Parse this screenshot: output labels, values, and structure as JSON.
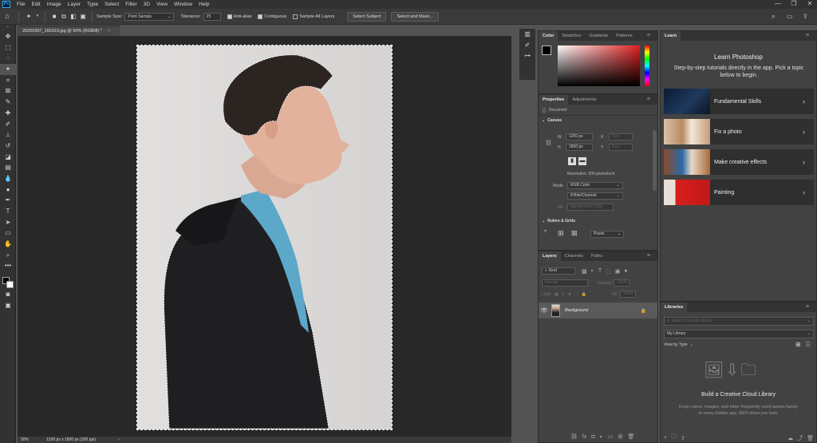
{
  "menu": {
    "logo": "Ps",
    "items": [
      "File",
      "Edit",
      "Image",
      "Layer",
      "Type",
      "Select",
      "Filter",
      "3D",
      "View",
      "Window",
      "Help"
    ],
    "window_controls": [
      "—",
      "❐",
      "✕"
    ]
  },
  "options": {
    "sample_size_label": "Sample Size:",
    "sample_size_value": "Point Sample",
    "tolerance_label": "Tolerance:",
    "tolerance_value": "25",
    "anti_alias": "Anti-alias",
    "contiguous": "Contiguous",
    "sample_all_layers": "Sample All Layers",
    "select_subject": "Select Subject",
    "select_and_mask": "Select and Mask..."
  },
  "document": {
    "tab_title": "20200307_160310.jpg @ 50% (RGB/8) *",
    "zoom": "50%",
    "dimensions": "1200 px x 1800 px (300 ppi)",
    "status_arrow": "›"
  },
  "color_panel": {
    "tabs": [
      "Color",
      "Swatches",
      "Gradients",
      "Patterns"
    ]
  },
  "properties_panel": {
    "tabs": [
      "Properties",
      "Adjustments"
    ],
    "document_label": "Document",
    "canvas_header": "Canvas",
    "w_label": "W",
    "w_value": "1200 px",
    "h_label": "H",
    "h_value": "1800 px",
    "x_label": "X",
    "x_placeholder": "0 px",
    "y_label": "Y",
    "y_placeholder": "0 px",
    "resolution": "Resolution: 300 pixels/inch",
    "mode_label": "Mode",
    "mode_value": "RGB Color",
    "bits_value": "8 Bits/Channel",
    "fill_label": "Fill",
    "fill_value": "Background Color",
    "rulers_header": "Rulers & Grids",
    "units_value": "Pixels"
  },
  "layers_panel": {
    "tabs": [
      "Layers",
      "Channels",
      "Paths"
    ],
    "kind_placeholder": "Kind",
    "blend_mode": "Normal",
    "opacity_label": "Opacity:",
    "opacity_value": "100%",
    "lock_label": "Lock:",
    "fill_label": "Fill:",
    "fill_value": "100%",
    "layer_name": "Background"
  },
  "learn_panel": {
    "tab": "Learn",
    "title": "Learn Photoshop",
    "subtitle": "Step-by-step tutorials directly in the app. Pick a topic below to begin.",
    "items": [
      {
        "label": "Fundamental Skills"
      },
      {
        "label": "Fix a photo"
      },
      {
        "label": "Make creative effects"
      },
      {
        "label": "Painting"
      }
    ]
  },
  "libraries_panel": {
    "tab": "Libraries",
    "search_placeholder": "Search Current Library",
    "library_name": "My Library",
    "view_by": "View by Type",
    "empty_title": "Build a Creative Cloud Library",
    "empty_body": "Keep colors, images, and other frequently used assets handy in every Adobe app. We'll show you how."
  },
  "colors": {
    "foreground": "#000000",
    "background": "#ffffff",
    "accent": "#31a8ff"
  }
}
